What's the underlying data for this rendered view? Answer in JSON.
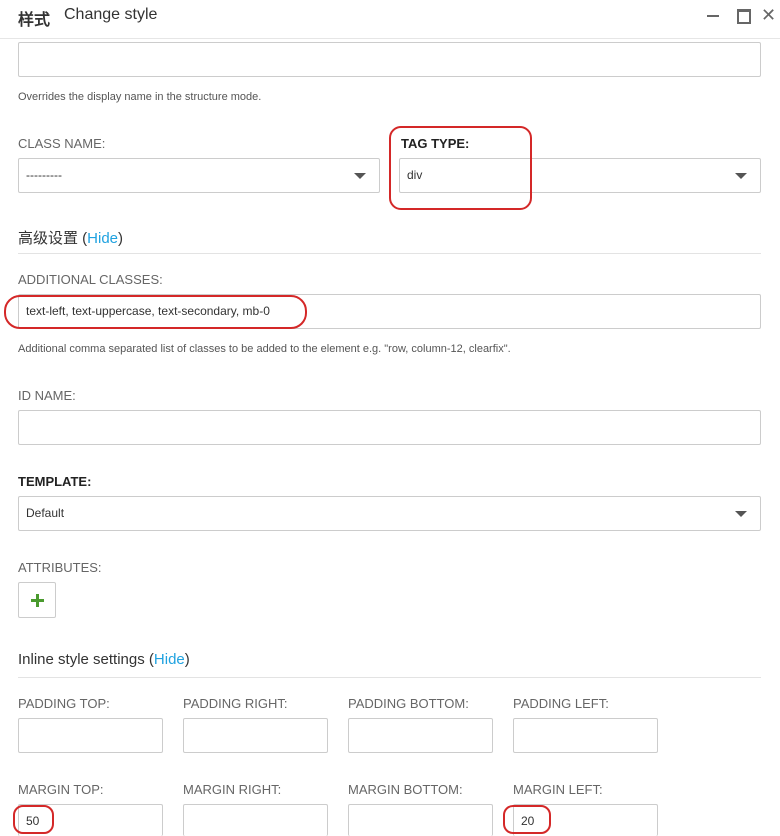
{
  "window": {
    "title_cn": "样式",
    "title_en": "Change style",
    "minimize_glyph": "",
    "maximize_glyph": "",
    "close_glyph": "✕"
  },
  "display_name": {
    "value": "",
    "help": "Overrides the display name in the structure mode."
  },
  "class_name": {
    "label": "CLASS NAME:",
    "value": "---------"
  },
  "tag_type": {
    "label": "TAG TYPE:",
    "value": "div"
  },
  "advanced": {
    "title": "高级设置 (",
    "link": "Hide",
    "close": ")"
  },
  "additional_classes": {
    "label": "ADDITIONAL CLASSES:",
    "value": "text-left, text-uppercase, text-secondary, mb-0",
    "help": "Additional comma separated list of classes to be added to the element e.g. \"row, column-12, clearfix\"."
  },
  "id_name": {
    "label": "ID NAME:",
    "value": ""
  },
  "template": {
    "label": "TEMPLATE:",
    "value": "Default"
  },
  "attributes": {
    "label": "ATTRIBUTES:"
  },
  "inline_style": {
    "title": "Inline style settings (",
    "link": "Hide",
    "close": ")"
  },
  "padding": {
    "top_label": "PADDING TOP:",
    "right_label": "PADDING RIGHT:",
    "bottom_label": "PADDING BOTTOM:",
    "left_label": "PADDING LEFT:",
    "top": "",
    "right": "",
    "bottom": "",
    "left": ""
  },
  "margin": {
    "top_label": "MARGIN TOP:",
    "right_label": "MARGIN RIGHT:",
    "bottom_label": "MARGIN BOTTOM:",
    "left_label": "MARGIN LEFT:",
    "top": "50",
    "right": "",
    "bottom": "",
    "left": "20"
  },
  "colors": {
    "link": "#1fa2e0",
    "highlight": "#d42828",
    "add_icon": "#4a9a2e"
  }
}
